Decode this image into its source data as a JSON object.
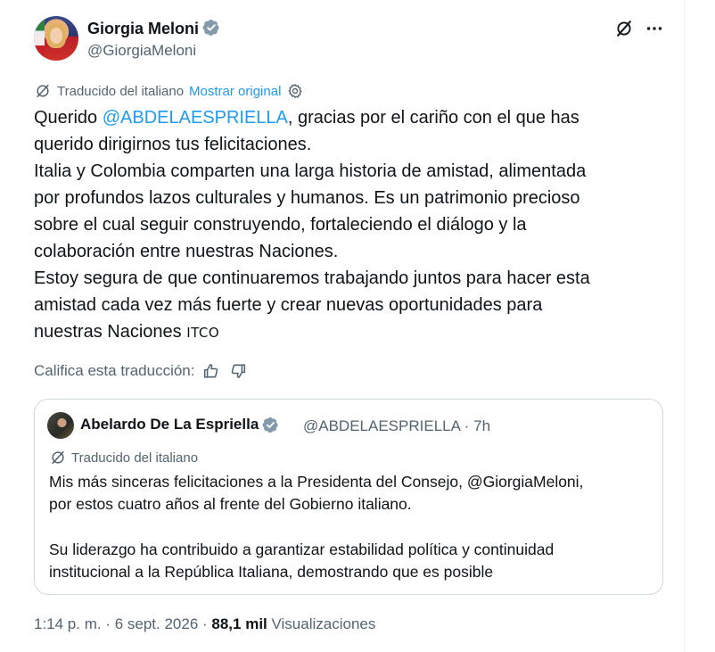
{
  "author": {
    "name": "Giorgia Meloni",
    "handle": "@GiorgiaMeloni"
  },
  "translation": {
    "label": "Traducido del italiano",
    "show_original": "Mostrar original"
  },
  "tweet": {
    "line1_prefix": "Querido ",
    "line1_mention": "@ABDELAESPRIELLA",
    "line1_suffix": ", gracias por el cariño con el que has",
    "line2": "querido dirigirnos tus felicitaciones.",
    "line3": "Italia y Colombia comparten una larga historia de amistad, alimentada",
    "line4": "por profundos lazos culturales y humanos. Es un patrimonio precioso",
    "line5": "sobre el cual seguir construyendo, fortaleciendo el diálogo y la",
    "line6": "colaboración entre nuestras Naciones.",
    "line7": "Estoy segura de que continuaremos trabajando juntos para hacer esta",
    "line8": "amistad cada vez más fuerte y crear nuevas oportunidades para",
    "line9_text": "nuestras Naciones ",
    "line9_flags": "ITCO"
  },
  "rate": {
    "label": "Califica esta traducción:"
  },
  "quote": {
    "name": "Abelardo De La Espriella",
    "handle_time": "@ABDELAESPRIELLA · 7h",
    "translated_label": "Traducido del italiano",
    "line1": "Mis más sinceras felicitaciones a la Presidenta del Consejo, @GiorgiaMeloni,",
    "line2": "por estos cuatro años al frente del Gobierno italiano.",
    "line3": "Su liderazgo ha contribuido a garantizar estabilidad política y continuidad",
    "line4": "institucional a la República Italiana, demostrando que es posible"
  },
  "meta": {
    "datetime": "1:14 p. m. · 6 sept. 2026 · ",
    "views_count": "88,1 mil",
    "views_label": " Visualizaciones"
  },
  "icons": {
    "verified": "verified-badge-icon",
    "grok": "grok-icon",
    "more": "more-icon",
    "translate": "translate-icon",
    "settings": "settings-icon",
    "thumbs_up": "thumbs-up-icon",
    "thumbs_down": "thumbs-down-icon"
  },
  "colors": {
    "accent": "#1d9bf0",
    "text": "#0f1419",
    "secondary": "#536471",
    "border": "#cfd9de",
    "verified": "#829aab"
  }
}
